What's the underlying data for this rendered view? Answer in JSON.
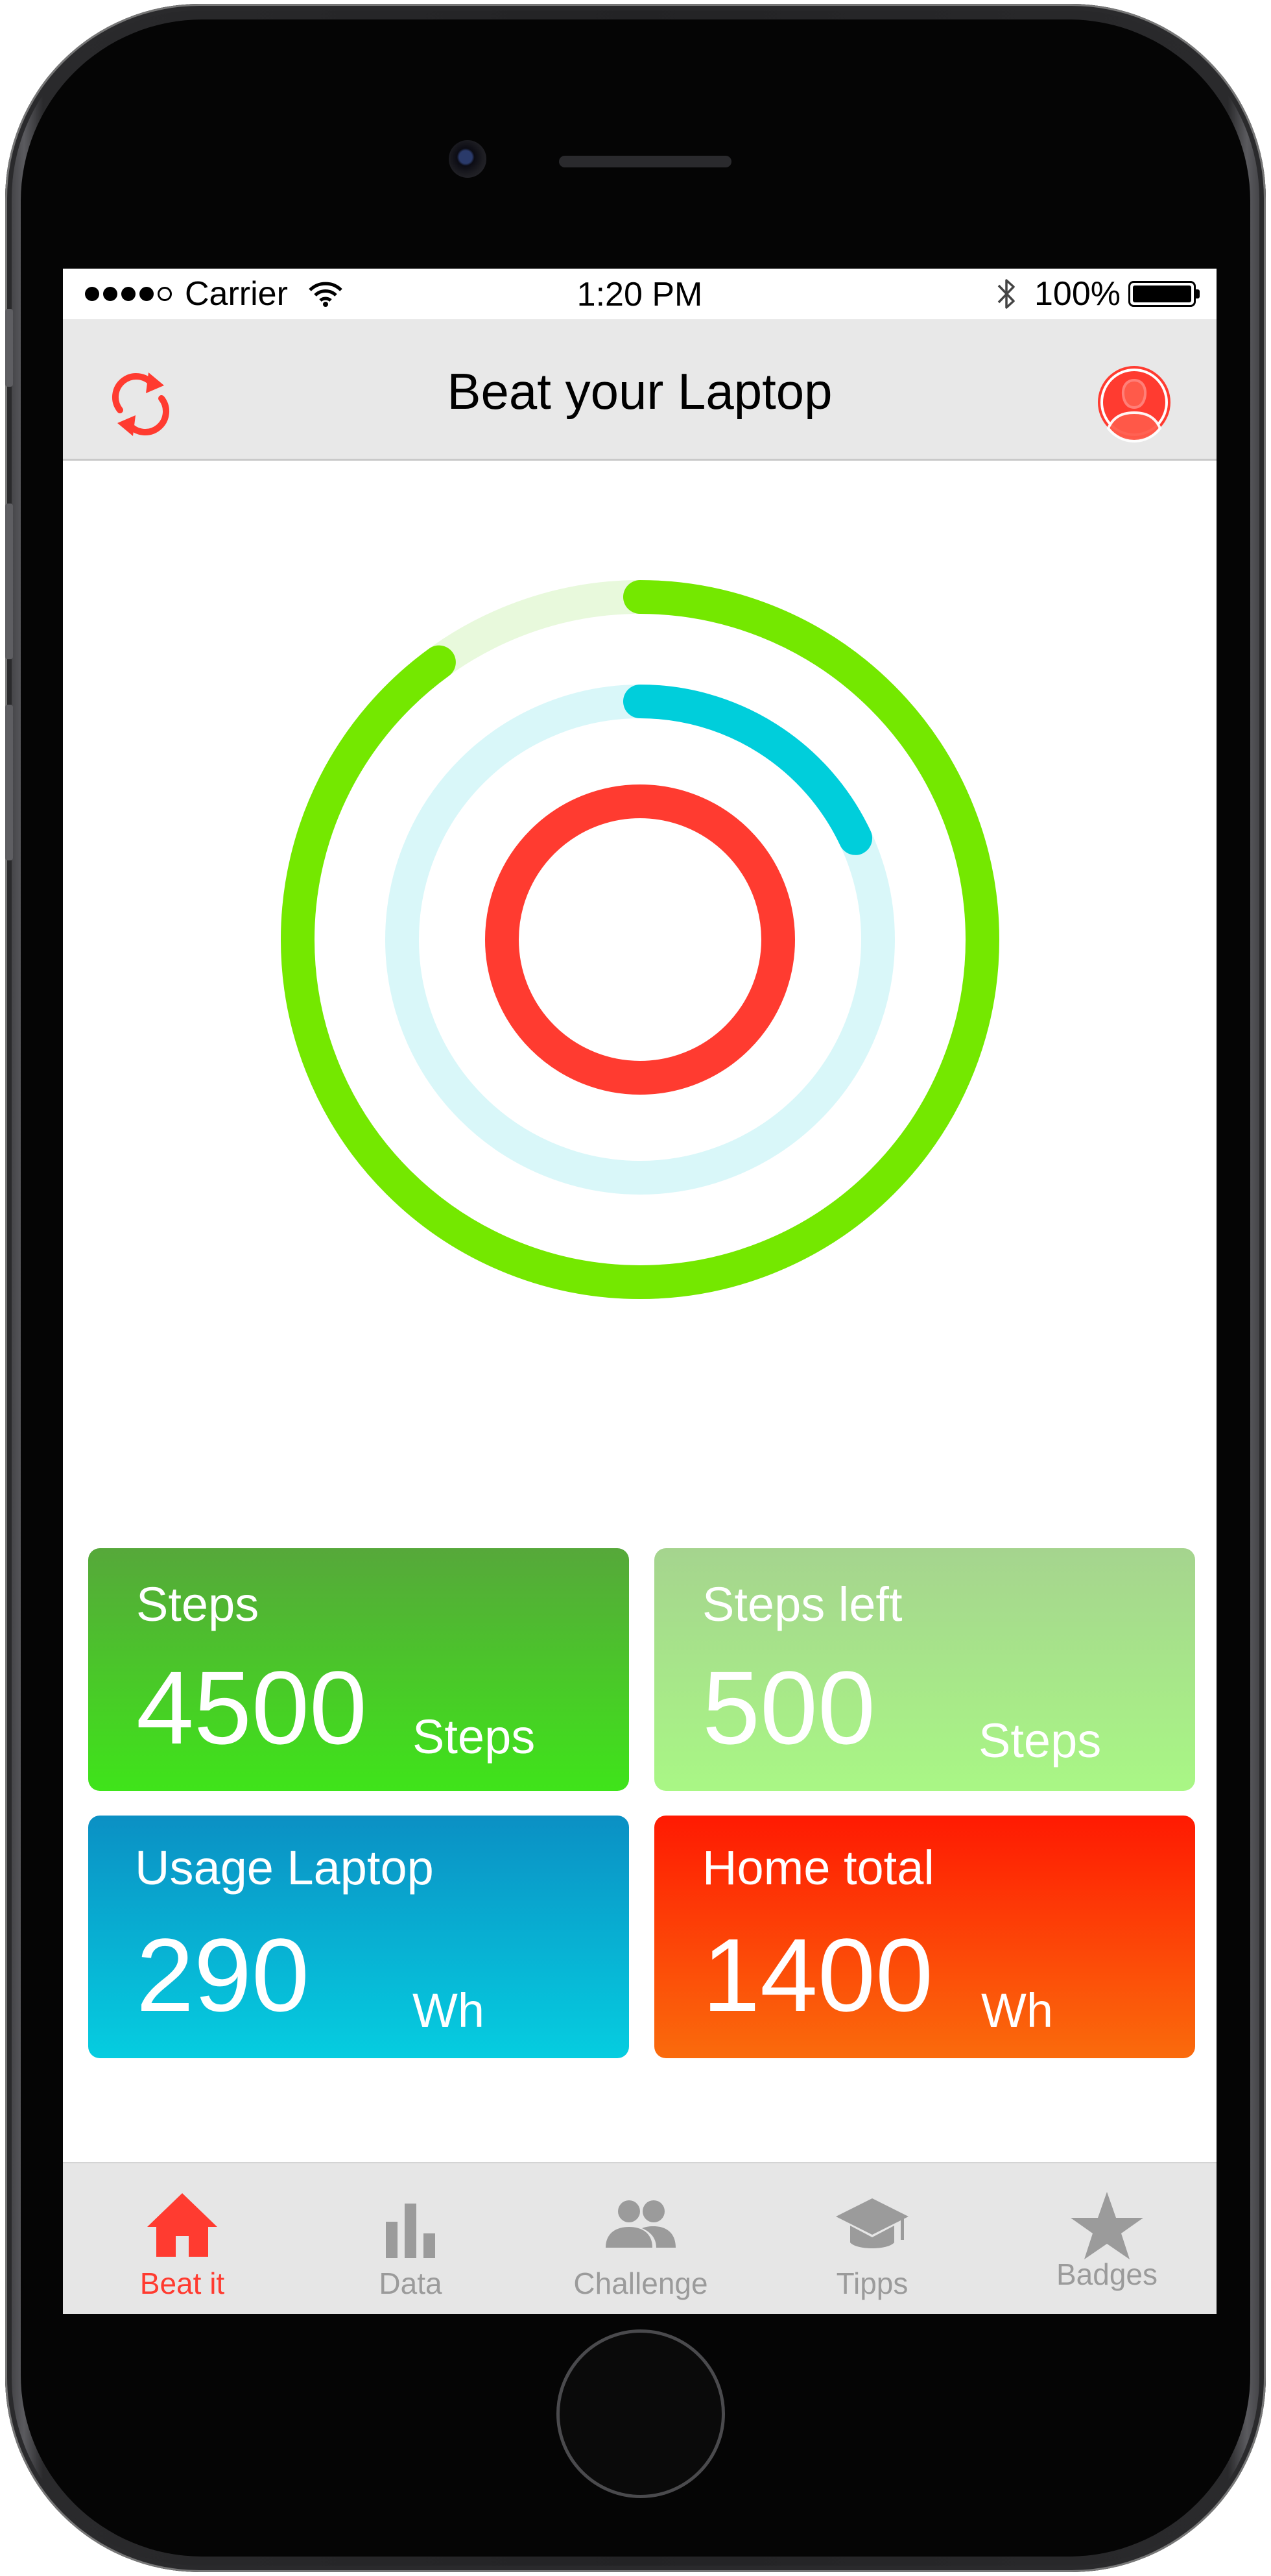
{
  "status_bar": {
    "carrier": "Carrier",
    "time": "1:20 PM",
    "battery": "100%"
  },
  "nav": {
    "title": "Beat your Laptop",
    "left_icon": "refresh-icon",
    "right_icon": "profile-icon",
    "accent": "#ff3b30"
  },
  "rings": {
    "outer": {
      "color": "#74e800",
      "track": "#e8f9dc",
      "progress": 0.9
    },
    "middle": {
      "color": "#00cedb",
      "track": "#d9f7f9",
      "progress": 0.18
    },
    "inner": {
      "color": "#ff3b30",
      "track": "#ffe0de",
      "progress": 1.0
    }
  },
  "tiles": {
    "steps": {
      "label": "Steps",
      "value": "4500",
      "unit": "Steps"
    },
    "steps_left": {
      "label": "Steps left",
      "value": "500",
      "unit": "Steps"
    },
    "usage_laptop": {
      "label": "Usage Laptop",
      "value": "290",
      "unit": "Wh"
    },
    "home_total": {
      "label": "Home total",
      "value": "1400",
      "unit": "Wh"
    }
  },
  "tabs": [
    {
      "label": "Beat it",
      "icon": "home-icon",
      "active": true
    },
    {
      "label": "Data",
      "icon": "bar-chart-icon",
      "active": false
    },
    {
      "label": "Challenge",
      "icon": "people-icon",
      "active": false
    },
    {
      "label": "Tipps",
      "icon": "graduation-cap-icon",
      "active": false
    },
    {
      "label": "Badges",
      "icon": "star-icon",
      "active": false
    }
  ]
}
